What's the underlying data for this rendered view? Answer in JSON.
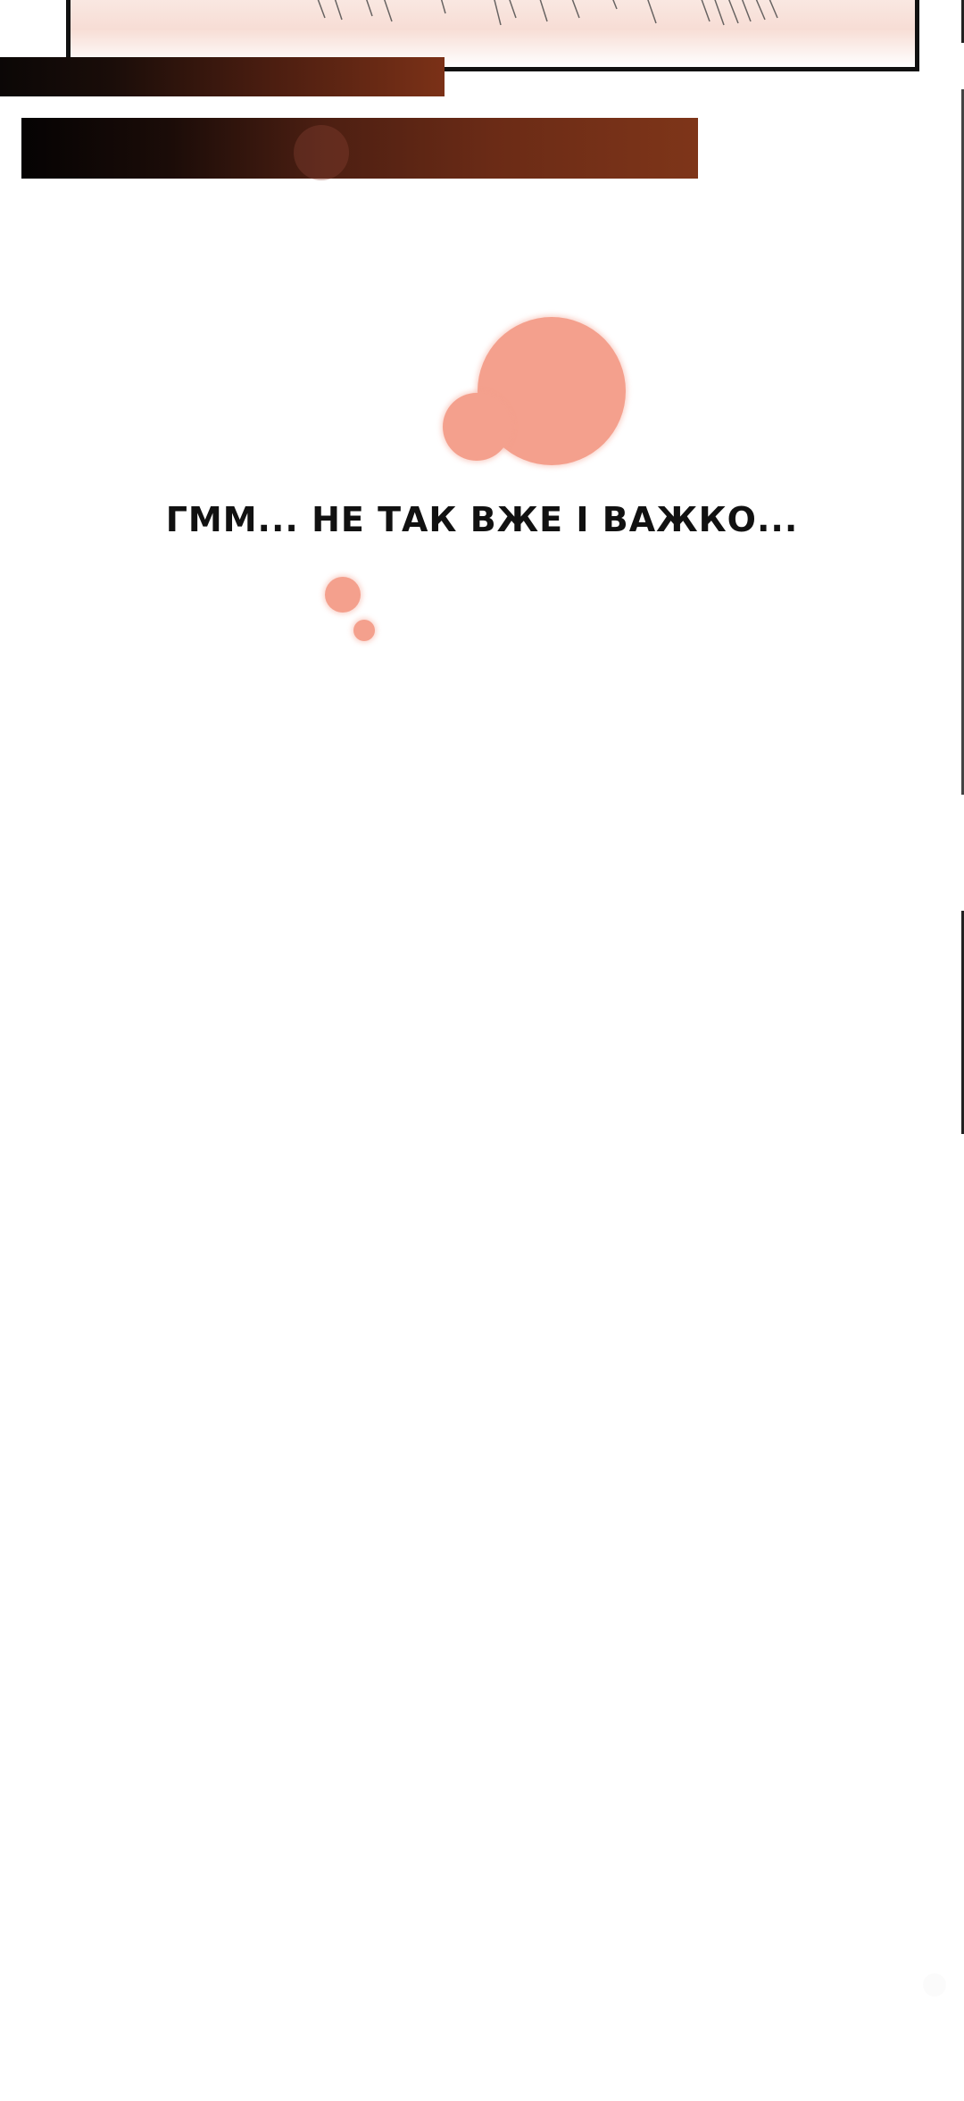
{
  "panel": {
    "caption": "ГММ... НЕ ТАК ВЖЕ І ВАЖКО..."
  },
  "colors": {
    "thought_bubble": "#f4a08d",
    "caption_text": "#111111",
    "panel_border": "#111111"
  }
}
